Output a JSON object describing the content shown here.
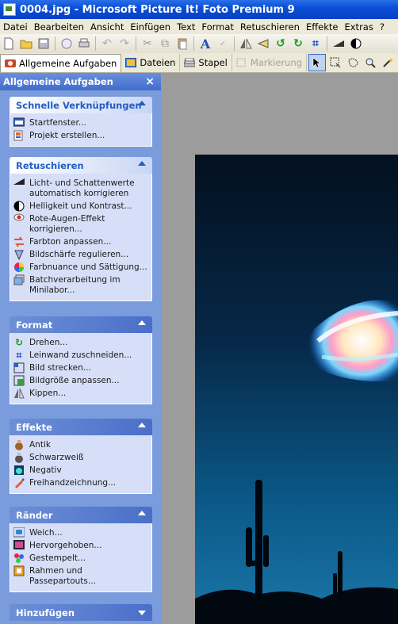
{
  "window": {
    "title": "0004.jpg - Microsoft Picture It! Foto Premium 9"
  },
  "menu": [
    "Datei",
    "Bearbeiten",
    "Ansicht",
    "Einfügen",
    "Text",
    "Format",
    "Retuschieren",
    "Effekte",
    "Extras",
    "?"
  ],
  "toolbar": {
    "icons": [
      "new-file-icon",
      "open-folder-icon",
      "save-icon",
      "email-icon",
      "print-icon",
      "undo-icon",
      "redo-icon",
      "cut-icon",
      "copy-icon",
      "paste-icon",
      "text-icon",
      "spellcheck-icon",
      "flip-icon",
      "mirror-icon",
      "rotate-left-icon",
      "rotate-right-icon",
      "crop-icon",
      "brightness-icon",
      "contrast-icon"
    ]
  },
  "tabs": [
    {
      "label": "Allgemeine Aufgaben",
      "state": "active"
    },
    {
      "label": "Dateien",
      "state": "normal"
    },
    {
      "label": "Stapel",
      "state": "normal"
    },
    {
      "label": "Markierung",
      "state": "disabled"
    }
  ],
  "panel": {
    "title": "Allgemeine Aufgaben",
    "sections": [
      {
        "title": "Schnelle Verknüpfungen",
        "items": [
          "Startfenster...",
          "Projekt erstellen..."
        ]
      },
      {
        "title": "Retuschieren",
        "items": [
          "Licht- und Schattenwerte automatisch korrigieren",
          "Helligkeit und Kontrast...",
          "Rote-Augen-Effekt korrigieren...",
          "Farbton anpassen...",
          "Bildschärfe regulieren...",
          "Farbnuance und Sättigung...",
          "Batchverarbeitung im Minilabor..."
        ]
      },
      {
        "title": "Format",
        "items": [
          "Drehen...",
          "Leinwand zuschneiden...",
          "Bild strecken...",
          "Bildgröße anpassen...",
          "Kippen..."
        ]
      },
      {
        "title": "Effekte",
        "items": [
          "Antik",
          "Schwarzweiß",
          "Negativ",
          "Freihandzeichnung..."
        ]
      },
      {
        "title": "Ränder",
        "items": [
          "Weich...",
          "Hervorgehoben...",
          "Gestempelt...",
          "Rahmen und Passepartouts..."
        ]
      },
      {
        "title": "Hinzufügen",
        "items": []
      }
    ]
  },
  "colors": {
    "title_bar": "#0a4fd6",
    "panel_bg": "#7a9bdc",
    "section_body": "#d6dff7",
    "section_title": "#215dc6",
    "canvas": "#9c9c9c"
  }
}
